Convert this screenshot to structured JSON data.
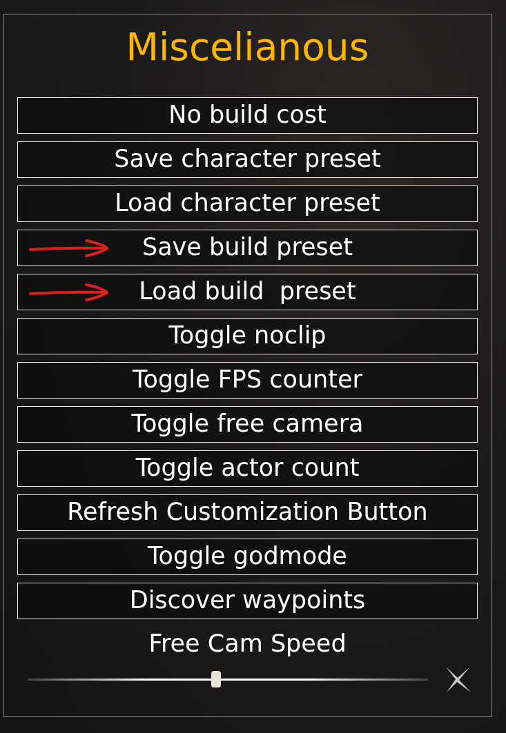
{
  "title": "Miscelianous",
  "buttons": [
    {
      "label": "No build cost",
      "annotated": false
    },
    {
      "label": "Save character preset",
      "annotated": false
    },
    {
      "label": "Load character preset",
      "annotated": false
    },
    {
      "label": "Save build preset",
      "annotated": true
    },
    {
      "label": "Load build  preset",
      "annotated": true
    },
    {
      "label": "Toggle noclip",
      "annotated": false
    },
    {
      "label": "Toggle FPS counter",
      "annotated": false
    },
    {
      "label": "Toggle free camera",
      "annotated": false
    },
    {
      "label": "Toggle actor count",
      "annotated": false
    },
    {
      "label": "Refresh Customization Button",
      "annotated": false
    },
    {
      "label": "Toggle godmode",
      "annotated": false
    },
    {
      "label": "Discover waypoints",
      "annotated": false
    }
  ],
  "speed": {
    "label": "Free Cam Speed",
    "level": 0.47
  }
}
